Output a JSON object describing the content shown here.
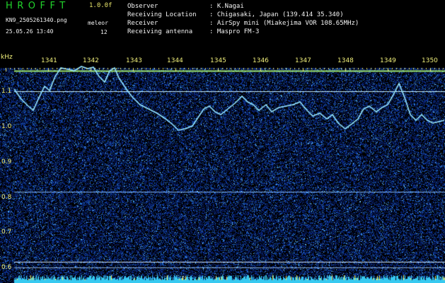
{
  "header": {
    "brand": "HROFFT",
    "version": "1.0.0f",
    "filename": "KN9_2505261340.png",
    "datetime": "25.05.26 13:40",
    "mode_label": "meleor",
    "count": "12"
  },
  "info": {
    "rows": [
      {
        "label": "Observer",
        "value": ": K.Nagai"
      },
      {
        "label": "Receiving Location",
        "value": ": Chigasaki, Japan (139.414 35.340)"
      },
      {
        "label": "Receiver",
        "value": ": AirSpy mini (Miakejima VOR 108.65MHz)"
      },
      {
        "label": "Receiving antenna",
        "value": ": Maspro FM-3"
      }
    ]
  },
  "axes": {
    "y_unit": "kHz",
    "x_ticks": [
      "1341",
      "1342",
      "1343",
      "1344",
      "1345",
      "1346",
      "1347",
      "1348",
      "1349",
      "1350"
    ],
    "y_ticks": [
      "1.1",
      "1.0",
      "0.9",
      "0.8",
      "0.7",
      "0.6"
    ]
  },
  "colors": {
    "background": "#000000",
    "noise_low": "#0a2a78",
    "noise_high": "#3aa0e8",
    "trace": "#7fe3ff",
    "line": "#c6f0ff",
    "tick": "#f0ef7a"
  }
}
